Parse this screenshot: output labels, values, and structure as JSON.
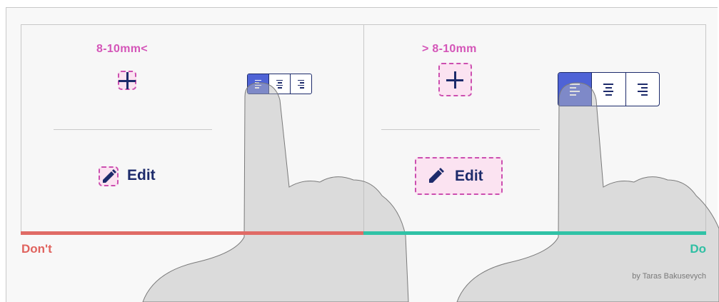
{
  "dont": {
    "size_label": "8-10mm<",
    "edit_label": "Edit",
    "verdict": "Don't",
    "accent": "#e06b66"
  },
  "do": {
    "size_label": "> 8-10mm",
    "edit_label": "Edit",
    "verdict": "Do",
    "accent": "#30c2a6"
  },
  "credit": "by Taras Bakusevych",
  "icons": [
    "plus-icon",
    "pencil-icon",
    "align-left-icon",
    "align-center-icon",
    "align-right-icon",
    "finger-illustration"
  ],
  "colors": {
    "target_outline": "#cc4fb0",
    "target_fill": "#fbe3f1",
    "icon": "#1d2b6b",
    "active_segment": "#4f63d6"
  }
}
